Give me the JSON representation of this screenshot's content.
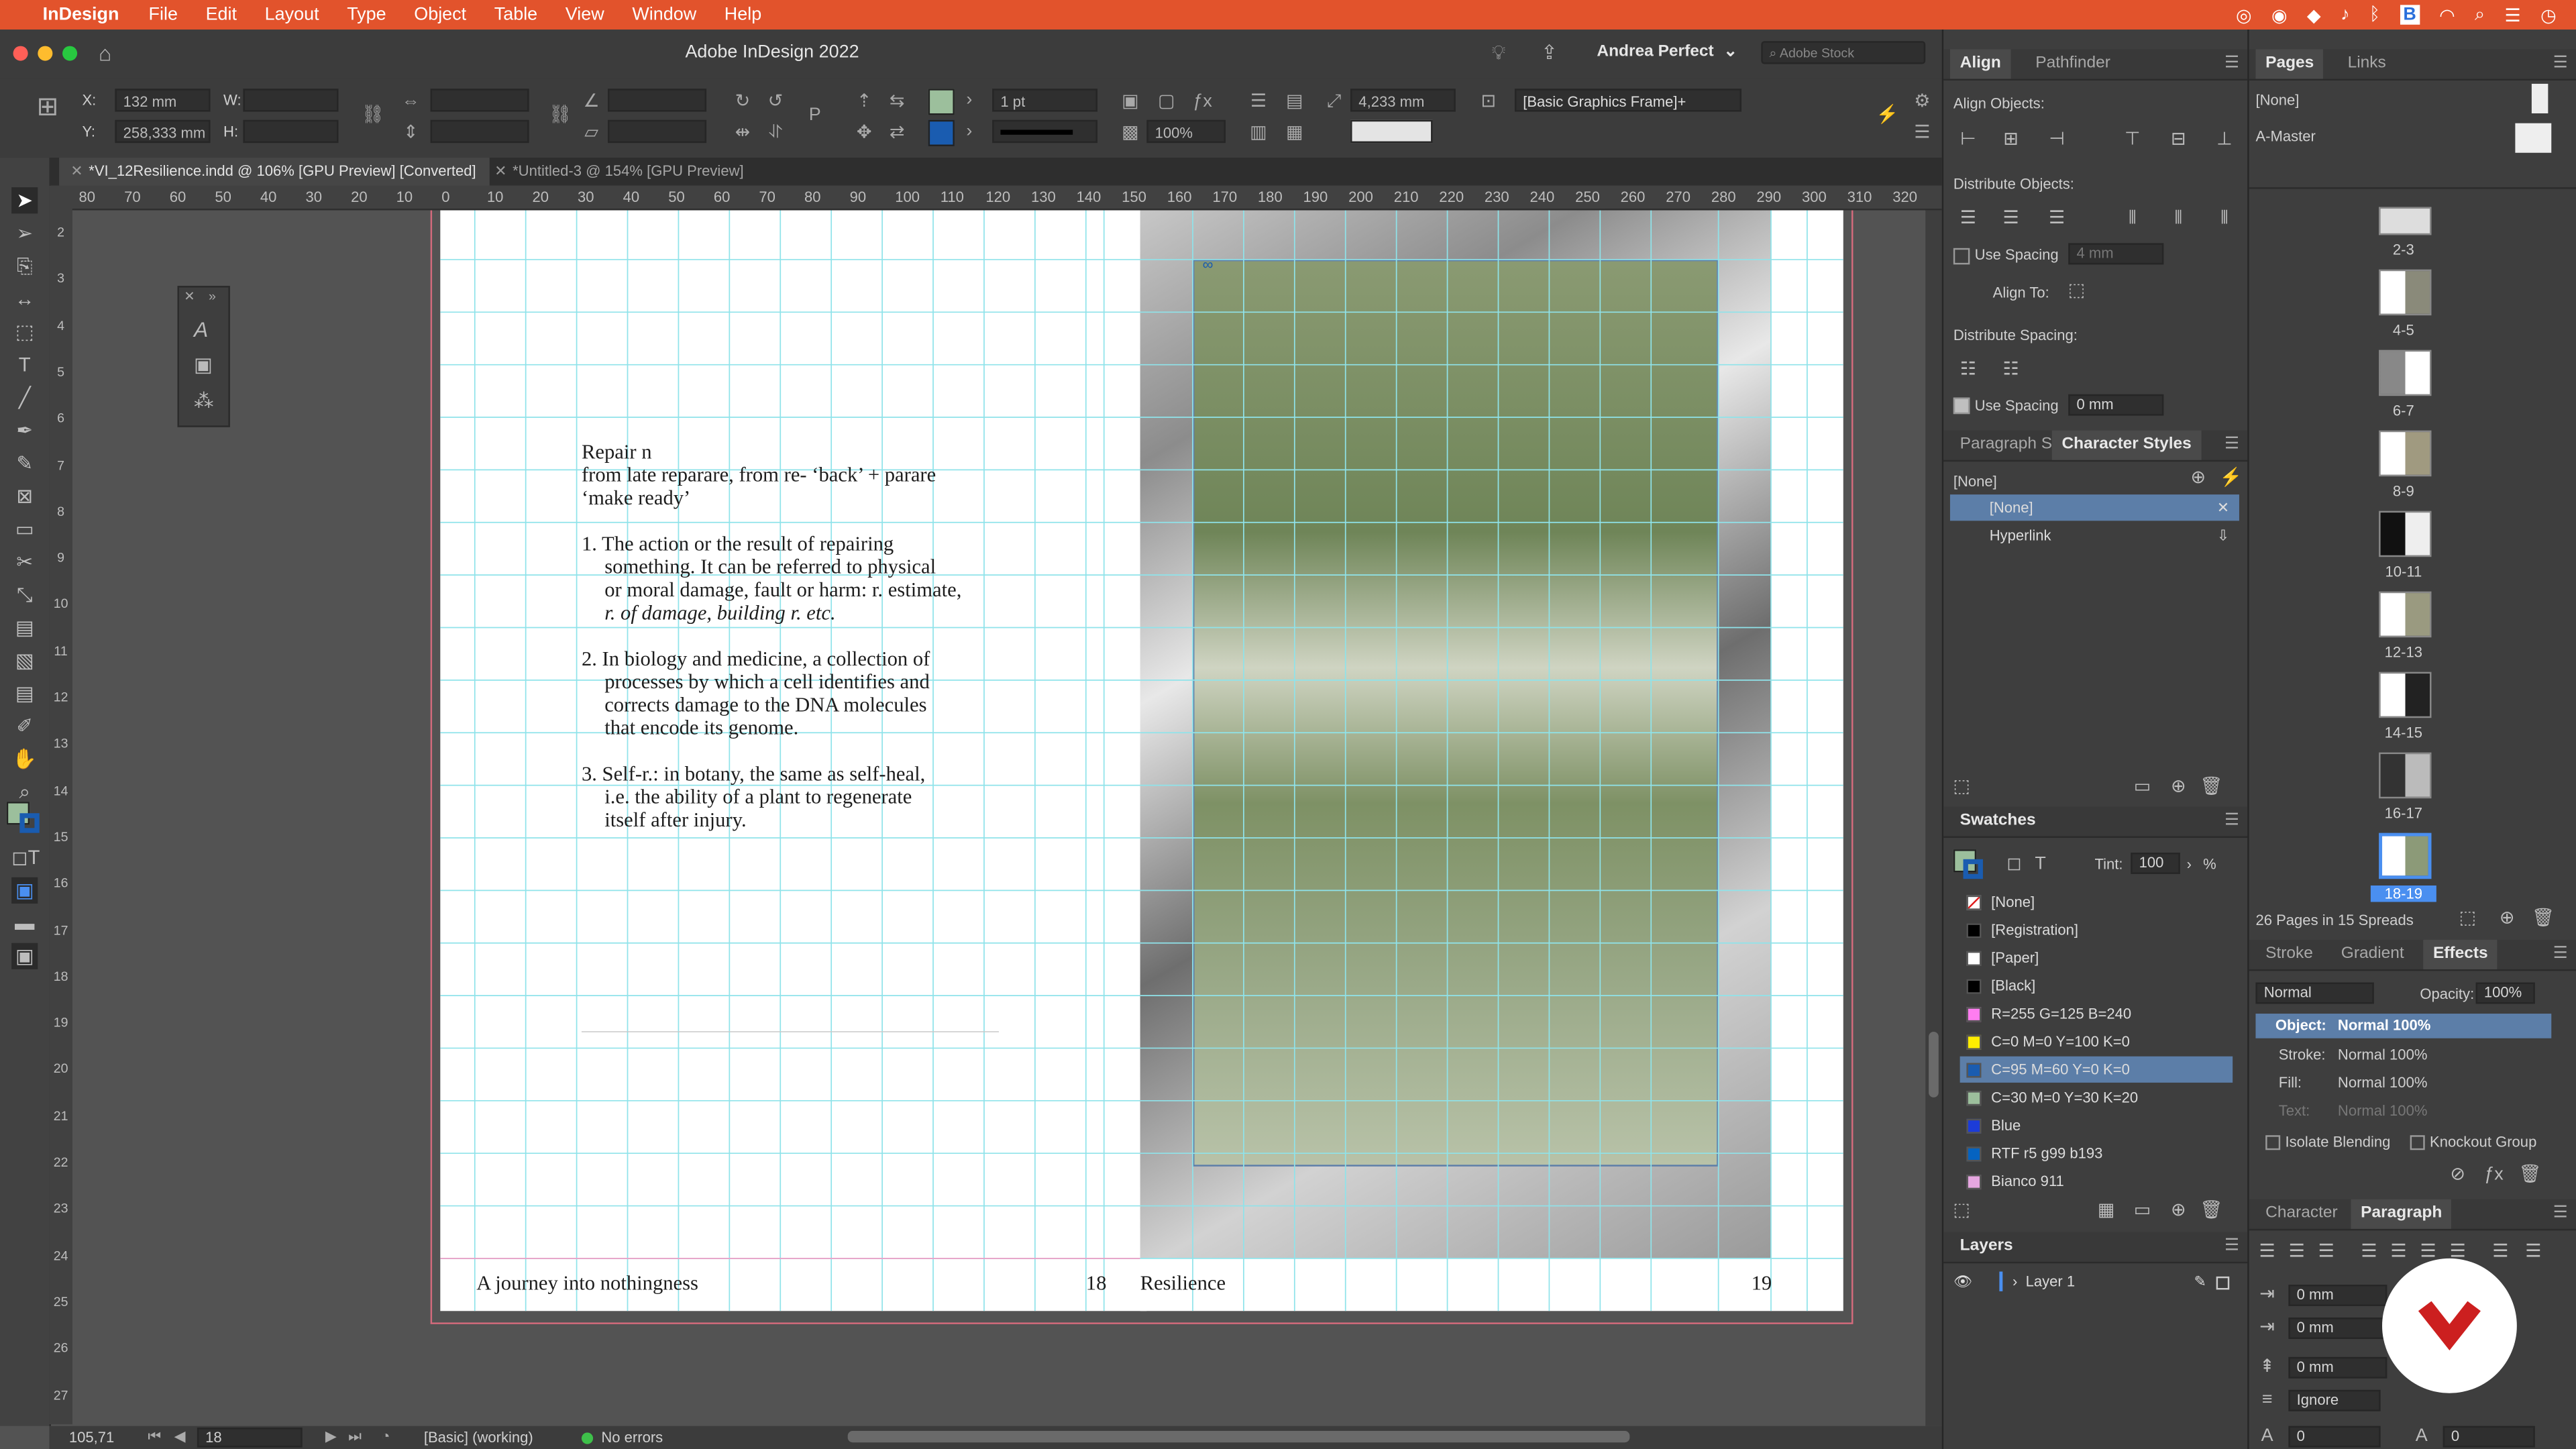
{
  "menubar": {
    "app": "InDesign",
    "items": [
      "File",
      "Edit",
      "Layout",
      "Type",
      "Object",
      "Table",
      "View",
      "Window",
      "Help"
    ]
  },
  "window": {
    "title": "Adobe InDesign 2022",
    "user": "Andrea Perfect",
    "stock_placeholder": "Adobe Stock"
  },
  "control": {
    "x_label": "X:",
    "x_value": "132 mm",
    "y_label": "Y:",
    "y_value": "258,333 mm",
    "w_label": "W:",
    "h_label": "H:",
    "stroke_weight": "1 pt",
    "scale_pct": "100%",
    "gap_value": "4,233 mm",
    "frame_style": "[Basic Graphics Frame]+"
  },
  "tabs": [
    {
      "label": "*VI_12Resilience.indd @ 106% [GPU Preview] [Converted]"
    },
    {
      "label": "*Untitled-3 @ 154% [GPU Preview]"
    }
  ],
  "hruler_ticks": [
    "80",
    "70",
    "60",
    "50",
    "40",
    "30",
    "20",
    "10",
    "0",
    "10",
    "20",
    "30",
    "40",
    "50",
    "60",
    "70",
    "80",
    "90",
    "100",
    "110",
    "120",
    "130",
    "140",
    "150",
    "160",
    "170",
    "180",
    "190",
    "200",
    "210",
    "220",
    "230",
    "240",
    "250",
    "260",
    "270",
    "280",
    "290",
    "300",
    "310",
    "320"
  ],
  "vruler_ticks": [
    "2",
    "3",
    "4",
    "5",
    "6",
    "7",
    "8",
    "9",
    "10",
    "11",
    "12",
    "13",
    "14",
    "15",
    "16",
    "17",
    "18",
    "19",
    "20",
    "21",
    "22",
    "23",
    "24",
    "25",
    "26",
    "27"
  ],
  "document": {
    "lines": [
      "Repair n",
      "from late reparare, from re- ‘back’ + parare",
      "‘make ready’",
      "1. The action or the result of repairing",
      "something. It can be referred to physical",
      "or moral damage, fault or harm: r. estimate,",
      "r. of damage, building r. etc.",
      "2. In biology and medicine, a collection of",
      "processes by which a cell identifies and",
      "corrects damage to the DNA molecules",
      "that encode its genome.",
      "3. Self-r.: in botany, the same as self-heal,",
      "i.e. the ability of a plant to regenerate",
      "itself after injury."
    ],
    "footer_left_title": "A journey into nothingness",
    "footer_left_page": "18",
    "footer_right_title": "Resilience",
    "footer_right_page": "19"
  },
  "status": {
    "zoom": "105,71",
    "page": "18",
    "profile": "[Basic] (working)",
    "errors": "No errors"
  },
  "align_panel": {
    "tabs": [
      "Align",
      "Pathfinder"
    ],
    "align_objects": "Align Objects:",
    "distribute_objects": "Distribute Objects:",
    "use_spacing_1": "Use Spacing",
    "spacing_1": "4 mm",
    "align_to": "Align To:",
    "distribute_spacing": "Distribute Spacing:",
    "use_spacing_2": "Use Spacing",
    "spacing_2": "0 mm"
  },
  "char_styles": {
    "tabs": [
      "Paragraph S",
      "Character Styles"
    ],
    "current": "[None]",
    "items": [
      "[None]",
      "Hyperlink"
    ]
  },
  "swatches": {
    "title": "Swatches",
    "tint_label": "Tint:",
    "tint_value": "100",
    "tint_unit": "%",
    "items": [
      {
        "name": "[None]",
        "color": "#ffffff"
      },
      {
        "name": "[Registration]",
        "color": "#000000"
      },
      {
        "name": "[Paper]",
        "color": "#ffffff"
      },
      {
        "name": "[Black]",
        "color": "#000000"
      },
      {
        "name": "R=255 G=125 B=240",
        "color": "#ff7df0"
      },
      {
        "name": "C=0 M=0 Y=100 K=0",
        "color": "#ffed00"
      },
      {
        "name": "C=95 M=60 Y=0 K=0",
        "color": "#1a5cb0"
      },
      {
        "name": "C=30 M=0 Y=30 K=20",
        "color": "#9cbf9c"
      },
      {
        "name": "Blue",
        "color": "#1c3cd8"
      },
      {
        "name": "RTF r5 g99 b193",
        "color": "#0563c1"
      },
      {
        "name": "Bianco 911",
        "color": "#e6a6e0"
      }
    ]
  },
  "layers": {
    "title": "Layers",
    "items": [
      "Layer 1"
    ]
  },
  "pages_panel": {
    "tabs": [
      "Pages",
      "Links"
    ],
    "none": "[None]",
    "master": "A-Master",
    "spreads": [
      "2-3",
      "4-5",
      "6-7",
      "8-9",
      "10-11",
      "12-13",
      "14-15",
      "16-17",
      "18-19"
    ],
    "summary": "26 Pages in 15 Spreads"
  },
  "effects_panel": {
    "tabs": [
      "Stroke",
      "Gradient",
      "Effects"
    ],
    "blend_mode": "Normal",
    "opacity_label": "Opacity:",
    "opacity": "100%",
    "object_label": "Object:",
    "object_value": "Normal 100%",
    "stroke_label": "Stroke:",
    "stroke_value": "Normal 100%",
    "fill_label": "Fill:",
    "fill_value": "Normal 100%",
    "text_label": "Text:",
    "text_value": "Normal 100%",
    "isolate": "Isolate Blending",
    "knockout": "Knockout Group"
  },
  "para_panel": {
    "tabs": [
      "Character",
      "Paragraph"
    ],
    "fields": [
      "0 mm",
      "0 mm",
      "0 mm",
      "Ignore",
      "0",
      "0"
    ]
  },
  "colors": {
    "menubar": "#e2532c",
    "selection": "#5c7ea8",
    "brand_badge": "#cc1f1f"
  }
}
